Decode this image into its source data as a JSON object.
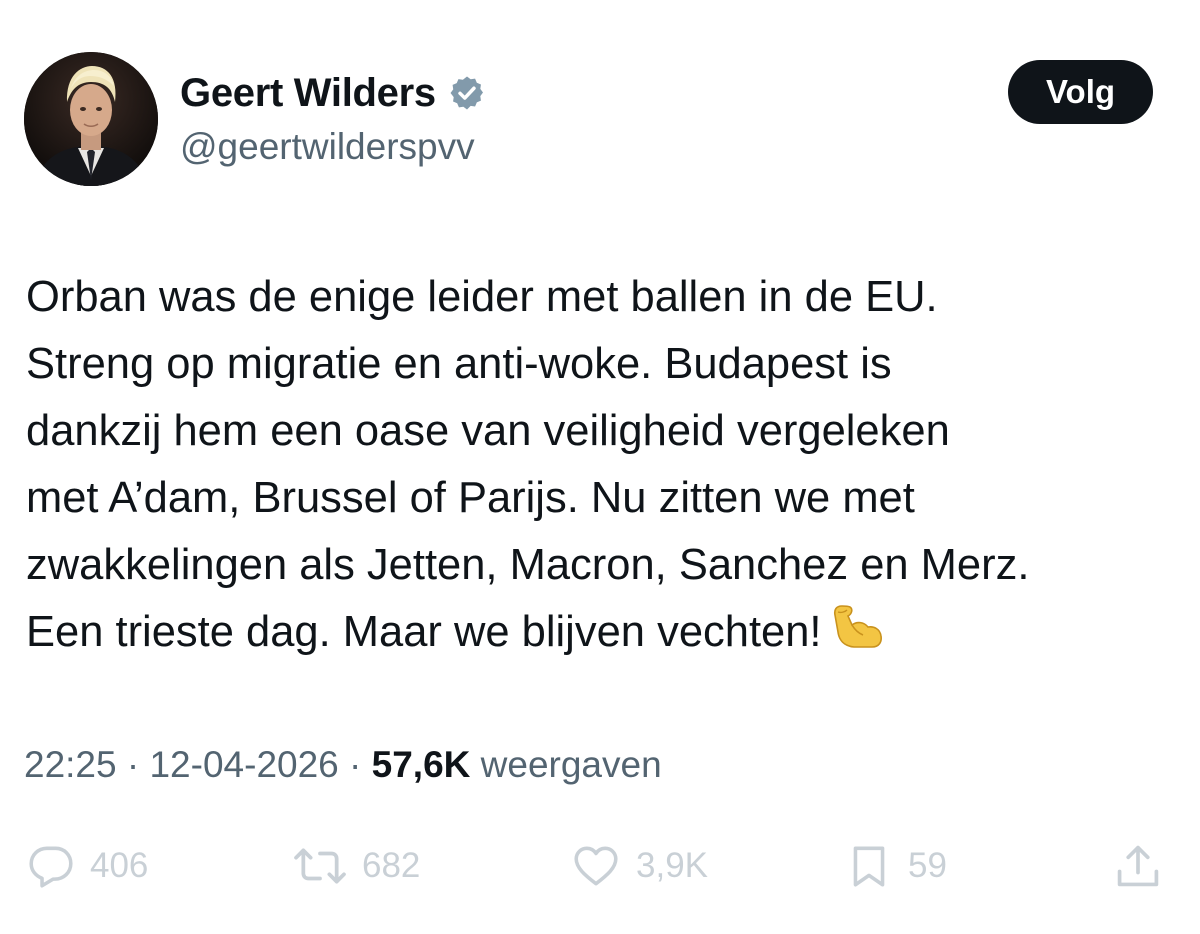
{
  "author": {
    "display_name": "Geert Wilders",
    "handle": "@geertwilderspvv",
    "verified": true
  },
  "follow_button": {
    "label": "Volg"
  },
  "tweet": {
    "lines": [
      "Orban was de enige leider met ballen in de EU.",
      "Streng op migratie en anti-woke. Budapest is",
      "dankzij hem een oase van veiligheid vergeleken",
      "met A’dam, Brussel of Parijs. Nu zitten we met",
      "zwakkelingen als Jetten, Macron, Sanchez en Merz.",
      "Een trieste dag. Maar we blijven vechten!"
    ],
    "emoji": "flexed-biceps"
  },
  "meta": {
    "time": "22:25",
    "separator": "·",
    "date": "12-04-2026",
    "views_count": "57,6K",
    "views_label": "weergaven"
  },
  "actions": {
    "replies": "406",
    "reposts": "682",
    "likes": "3,9K",
    "bookmarks": "59"
  },
  "colors": {
    "text": "#0f1419",
    "secondary": "#536471",
    "action_icons": "#c9d0d6",
    "follow_button_bg": "#0f1419",
    "verified_badge": "#829aab"
  },
  "icons": {
    "verified": "verified-badge-icon",
    "reply": "reply-bubble-icon",
    "repost": "repost-arrows-icon",
    "like": "heart-icon",
    "bookmark": "bookmark-icon",
    "share": "share-upload-icon"
  }
}
